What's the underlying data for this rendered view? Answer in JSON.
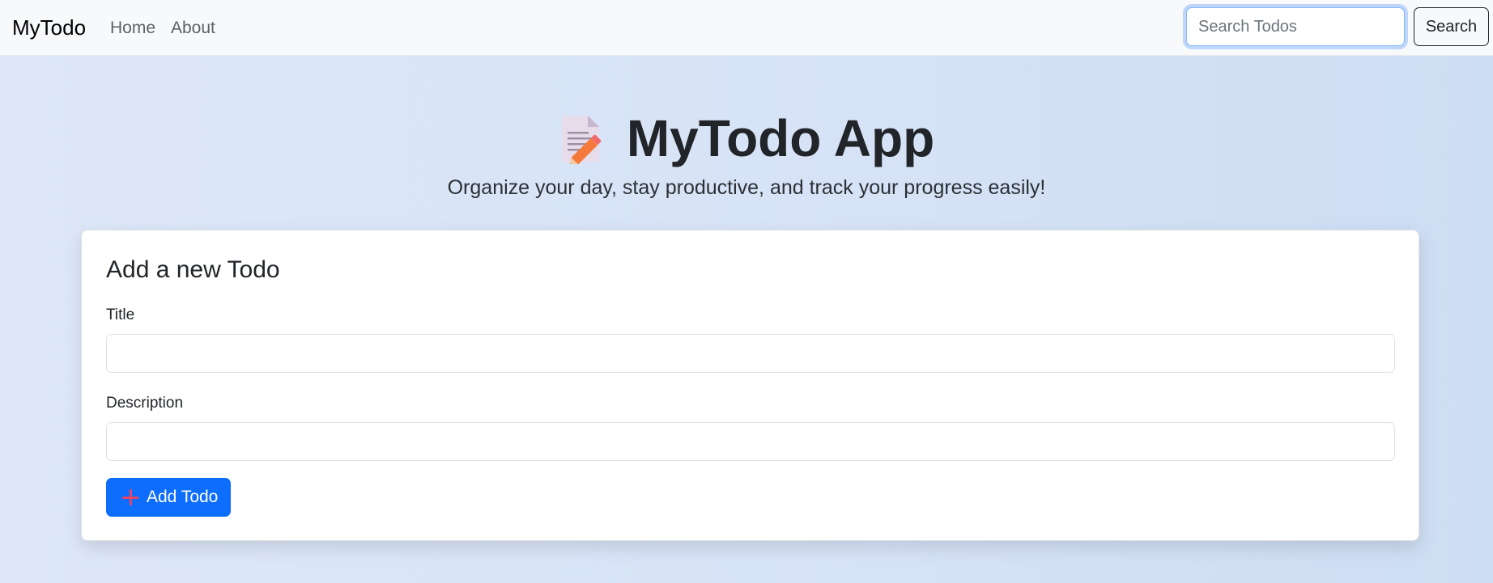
{
  "navbar": {
    "brand": "MyTodo",
    "links": [
      "Home",
      "About"
    ],
    "search": {
      "placeholder": "Search Todos",
      "value": "",
      "button_label": "Search"
    }
  },
  "hero": {
    "icon": "memo-icon",
    "title": "MyTodo App",
    "subtitle": "Organize your day, stay productive, and track your progress easily!"
  },
  "form": {
    "heading": "Add a new Todo",
    "title_label": "Title",
    "title_value": "",
    "description_label": "Description",
    "description_value": "",
    "submit_icon": "plus-icon",
    "submit_label": "Add Todo"
  },
  "colors": {
    "primary": "#0d6efd",
    "navbar_bg": "#f8f9fa",
    "plus_icon": "#e0466a"
  }
}
